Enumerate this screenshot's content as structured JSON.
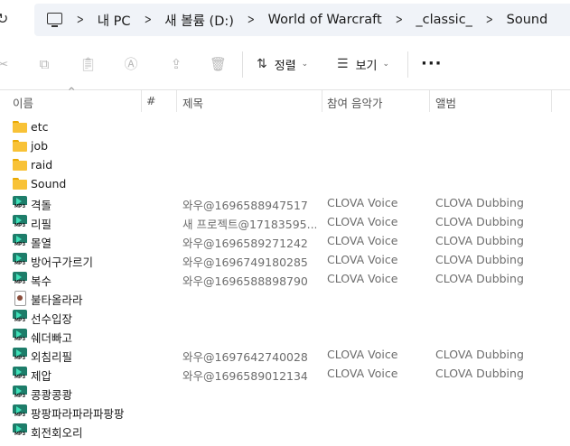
{
  "breadcrumb": {
    "segments": [
      "내 PC",
      "새 볼륨 (D:)",
      "World of Warcraft",
      "_classic_",
      "Sound"
    ]
  },
  "toolbar": {
    "sort_label": "정렬",
    "view_label": "보기",
    "more_label": "···"
  },
  "columns": {
    "name": "이름",
    "number": "#",
    "title": "제목",
    "artist": "참여 음악가",
    "album": "앨범"
  },
  "files": [
    {
      "name": "etc",
      "kind": "folder",
      "title": "",
      "artist": "",
      "album": ""
    },
    {
      "name": "job",
      "kind": "folder",
      "title": "",
      "artist": "",
      "album": ""
    },
    {
      "name": "raid",
      "kind": "folder",
      "title": "",
      "artist": "",
      "album": ""
    },
    {
      "name": "Sound",
      "kind": "folder",
      "title": "",
      "artist": "",
      "album": ""
    },
    {
      "name": "격돌",
      "kind": "mp3",
      "title": "와우@1696588947517",
      "artist": "CLOVA Voice",
      "album": "CLOVA Dubbing"
    },
    {
      "name": "리필",
      "kind": "mp3",
      "title": "새 프로젝트@17183595...",
      "artist": "CLOVA Voice",
      "album": "CLOVA Dubbing"
    },
    {
      "name": "몰열",
      "kind": "mp3",
      "title": "와우@1696589271242",
      "artist": "CLOVA Voice",
      "album": "CLOVA Dubbing"
    },
    {
      "name": "방어구가르기",
      "kind": "mp3",
      "title": "와우@1696749180285",
      "artist": "CLOVA Voice",
      "album": "CLOVA Dubbing"
    },
    {
      "name": "복수",
      "kind": "mp3",
      "title": "와우@1696588898790",
      "artist": "CLOVA Voice",
      "album": "CLOVA Dubbing"
    },
    {
      "name": "불타올라라",
      "kind": "wav",
      "title": "",
      "artist": "",
      "album": ""
    },
    {
      "name": "선수입장",
      "kind": "mp3",
      "title": "",
      "artist": "",
      "album": ""
    },
    {
      "name": "쉐더빠고",
      "kind": "mp3",
      "title": "",
      "artist": "",
      "album": ""
    },
    {
      "name": "외침리필",
      "kind": "mp3",
      "title": "와우@1697642740028",
      "artist": "CLOVA Voice",
      "album": "CLOVA Dubbing"
    },
    {
      "name": "제압",
      "kind": "mp3",
      "title": "와우@1696589012134",
      "artist": "CLOVA Voice",
      "album": "CLOVA Dubbing"
    },
    {
      "name": "콩쾅콩쾅",
      "kind": "mp3",
      "title": "",
      "artist": "",
      "album": ""
    },
    {
      "name": "팡팡파라파라파팡팡",
      "kind": "mp3",
      "title": "",
      "artist": "",
      "album": ""
    },
    {
      "name": "회전회오리",
      "kind": "mp3",
      "title": "",
      "artist": "",
      "album": ""
    }
  ],
  "icons": {
    "folder": "folder-icon",
    "mp3": "mp3-file-icon",
    "wav": "audio-file-icon"
  },
  "mp3_badge": "MP3"
}
